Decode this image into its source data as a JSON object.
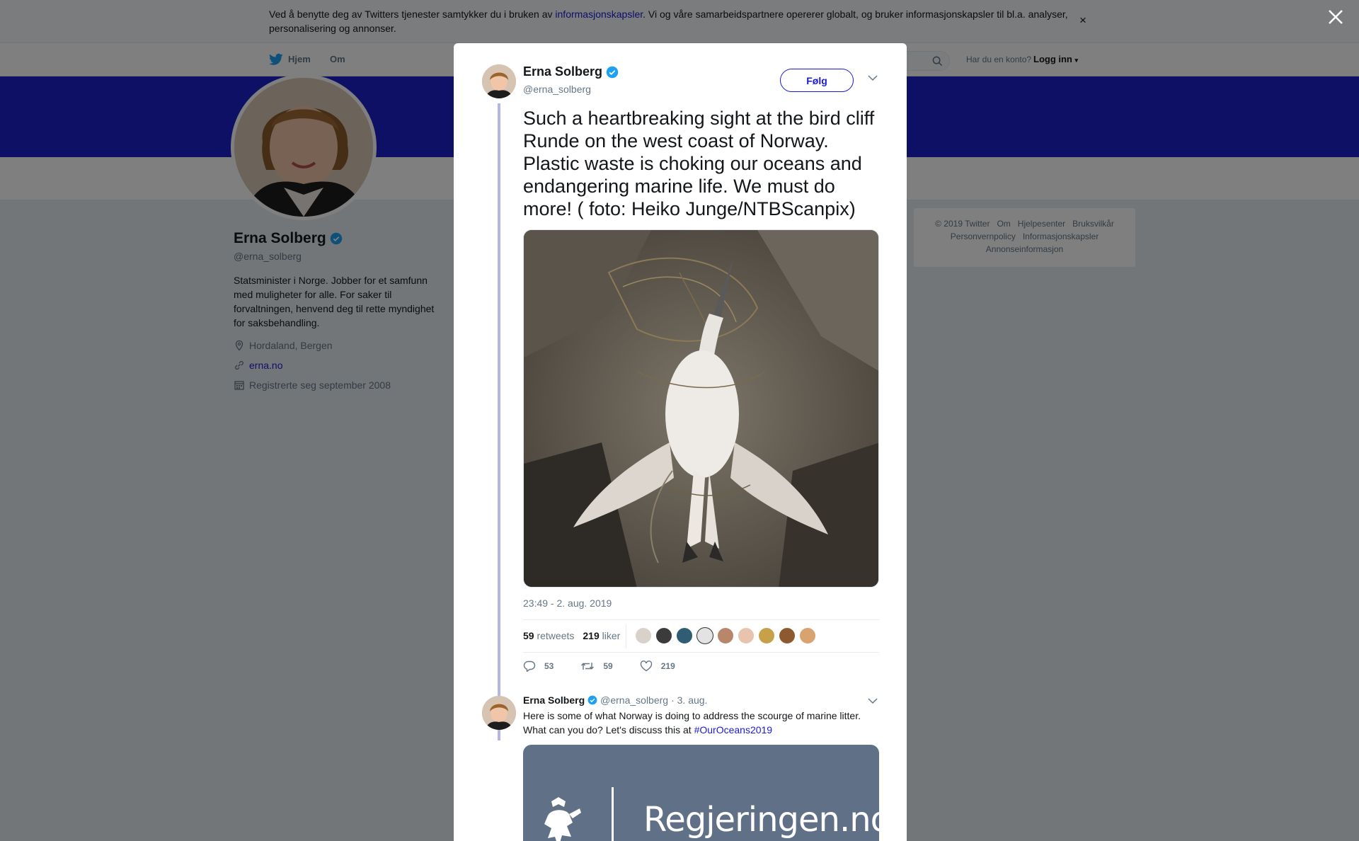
{
  "cookie_banner": {
    "text_before": "Ved å benytte deg av Twitters tjenester samtykker du i bruken av ",
    "link": "informasjonskapsler",
    "text_after": ". Vi og våre samarbeidspartnere opererer globalt, og bruker informasjonskapsler til bl.a. analyser, personalisering og annonser.",
    "close": "×"
  },
  "nav": {
    "home": "Hjem",
    "about": "Om",
    "account_question": "Har du en konto?",
    "login": "Logg inn"
  },
  "profile": {
    "name": "Erna Solberg",
    "handle": "@erna_solberg",
    "bio": "Statsminister i Norge. Jobber for et samfunn med muligheter for alle. For saker til forvaltningen, henvend deg til rette myndighet for saksbehandling.",
    "location": "Hordaland, Bergen",
    "website": "erna.no",
    "joined": "Registrerte seg september 2008"
  },
  "footer": {
    "copyright": "© 2019 Twitter",
    "about": "Om",
    "help": "Hjelpesenter",
    "terms": "Bruksvilkår",
    "privacy": "Personvernpolicy",
    "cookies": "Informasjonskapsler",
    "ads": "Annonseinformasjon"
  },
  "tweet": {
    "name": "Erna Solberg",
    "handle": "@erna_solberg",
    "follow": "Følg",
    "text": "Such a heartbreaking sight at the bird cliff Runde on the west coast of Norway. Plastic waste is choking our oceans and endangering marine life. We must do more! ( foto: Heiko Junge/NTBScanpix)",
    "timestamp": "23:49 - 2. aug. 2019",
    "retweets_count": "59",
    "retweets_label": "retweets",
    "likes_count": "219",
    "likes_label": "liker",
    "replies_action": "53",
    "retweets_action": "59",
    "likes_action": "219"
  },
  "reply": {
    "name": "Erna Solberg",
    "handle": "@erna_solberg",
    "date": "· 3. aug.",
    "text": "Here is some of what Norway is doing to address the scourge of marine litter. What can you do? Let's discuss this at ",
    "hashtag": "#OurOceans2019",
    "card_site": "Regjeringen.no"
  },
  "colors": {
    "link": "#1b1bd6",
    "banner": "#1a20c8",
    "verified": "#1da1f2"
  }
}
